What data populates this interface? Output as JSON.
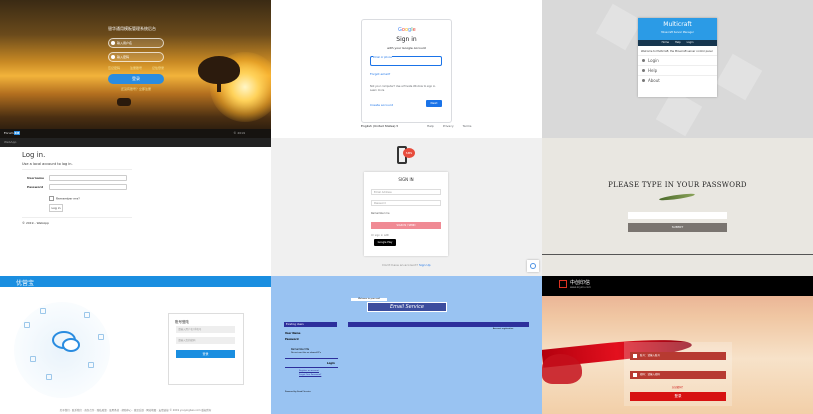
{
  "tiles": {
    "sunset": {
      "title": "银华通用模板管理系统后台",
      "username_placeholder": "输入用户名",
      "password_placeholder": "输入密码",
      "links": [
        "忘记密码",
        "注册账号",
        "记住登录"
      ],
      "login_button": "登录",
      "register_link": "还没有账号？立即注册",
      "footer_logo": [
        "Forum",
        "Kit"
      ],
      "footer_right": "© 2019"
    },
    "google": {
      "logo_letters": [
        "G",
        "o",
        "o",
        "g",
        "l",
        "e"
      ],
      "heading": "Sign in",
      "subheading": "with your Google Account",
      "email_label": "Email or phone",
      "email_value": "|",
      "forgot": "Forgot email?",
      "guest_note": "Not your computer? Use a Private Window to sign in. Learn more",
      "create_account": "Create account",
      "next_button": "Next",
      "language": "English (United States) ▾",
      "footer_links": [
        "Help",
        "Privacy",
        "Terms"
      ]
    },
    "multicraft": {
      "title": "Multicraft",
      "subtitle": "Minecraft Server Manager",
      "nav": [
        "Home",
        "Help",
        "Login"
      ],
      "welcome": "Welcome to Multicraft, the Minecraft server control panel",
      "menu": [
        "Login",
        "Help",
        "About"
      ]
    },
    "aspnet": {
      "brand": "WebApp",
      "heading": "Log in.",
      "subheading": "Use a local account to log in.",
      "username_label": "Username",
      "password_label": "Password",
      "remember": "Remember me?",
      "login_button": "Log in",
      "copyright": "© 2019 - WebApp"
    },
    "sms": {
      "badge": "SMS",
      "heading": "SIGN IN",
      "email_placeholder": "Email Address",
      "password_placeholder": "Password",
      "remember": "Remember me",
      "button": "SIGN IN / SEND",
      "social": "Or sign in with",
      "store_badge": "Google Play",
      "footer_text": "Don't have an account?",
      "footer_link": "Sign Up"
    },
    "password": {
      "heading": "PLEASE TYPE IN YOUR PASSWORD",
      "submit": "SUBMIT"
    },
    "youyingbao": {
      "brand": "优营宝",
      "card_title": "账号登陆",
      "username_placeholder": "请输入用户名/手机号",
      "password_placeholder": "请输入您的密码",
      "login_button": "登录",
      "footer": "关于我们 · 联系我们 · 商务合作 · 隐私政策 · 使用条款 · 帮助中心 · 意见反馈 · 网站地图 · 友情链接 © 2019 youyingbao.com 版权所有"
    },
    "email": {
      "tag": "Welcome to your mail",
      "banner": "Email Service",
      "login_header": "Existing Users",
      "right_note": "Account registration",
      "user_name_label": "User Name",
      "password_label": "Password",
      "remember": "Remember Me",
      "do_not_use": "Do not use this on shared PCs",
      "login_button": "Login",
      "links": [
        "Register an account",
        "Forgot Your Password?"
      ],
      "powered": "Powered by Email Service"
    },
    "zhongchuang": {
      "brand": "中创印信",
      "url": "www.zcyxin.com",
      "username_placeholder": "账号：请输入账号",
      "password_placeholder": "密码：请输入密码",
      "hint": "忘记密码？",
      "login_button": "登录"
    }
  },
  "colors": {
    "google_blue": "#1a73e8",
    "multicraft_blue": "#2b9be6",
    "youyingbao_blue": "#1a8ee0",
    "email_navy": "#2d2f9c",
    "zhongchuang_red": "#d71111"
  }
}
